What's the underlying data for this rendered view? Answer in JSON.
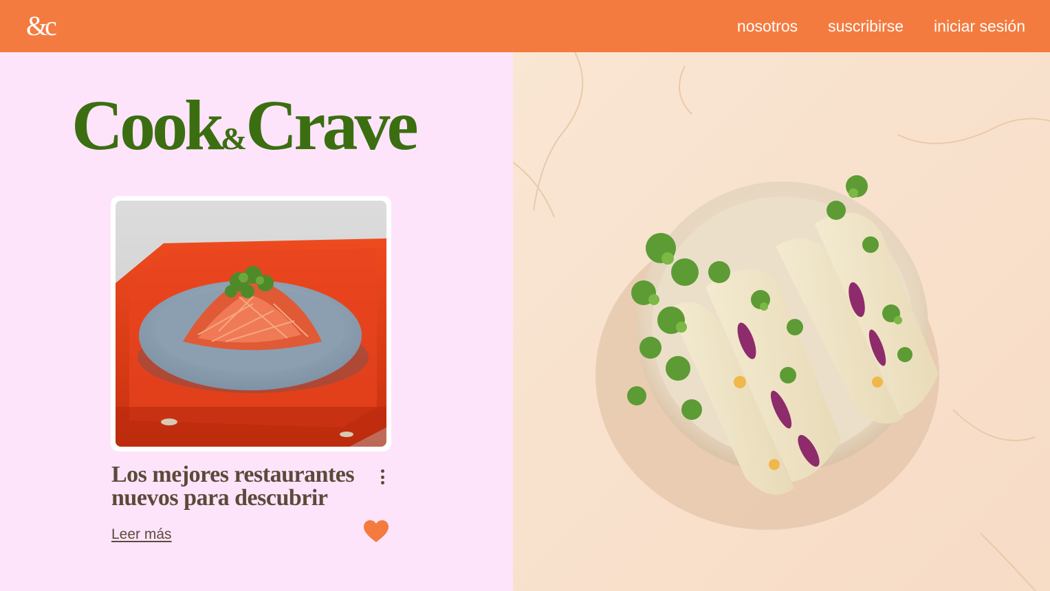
{
  "header": {
    "logo_text": "&c",
    "nav": [
      {
        "label": "nosotros"
      },
      {
        "label": "suscribirse"
      },
      {
        "label": "iniciar sesión"
      }
    ]
  },
  "hero": {
    "brand_cook": "Cook",
    "brand_amp": "&",
    "brand_crave": "Crave"
  },
  "card": {
    "title": "Los mejores restaurantes nuevos para descubrir",
    "read_more": "Leer más",
    "more_options_icon": "kebab-menu-icon",
    "favorite_icon": "heart-icon"
  },
  "colors": {
    "header_bg": "#f47b3f",
    "left_bg": "#fde4fa",
    "brand": "#3b6e10",
    "text": "#5c4a3a",
    "heart": "#f47b3f"
  }
}
